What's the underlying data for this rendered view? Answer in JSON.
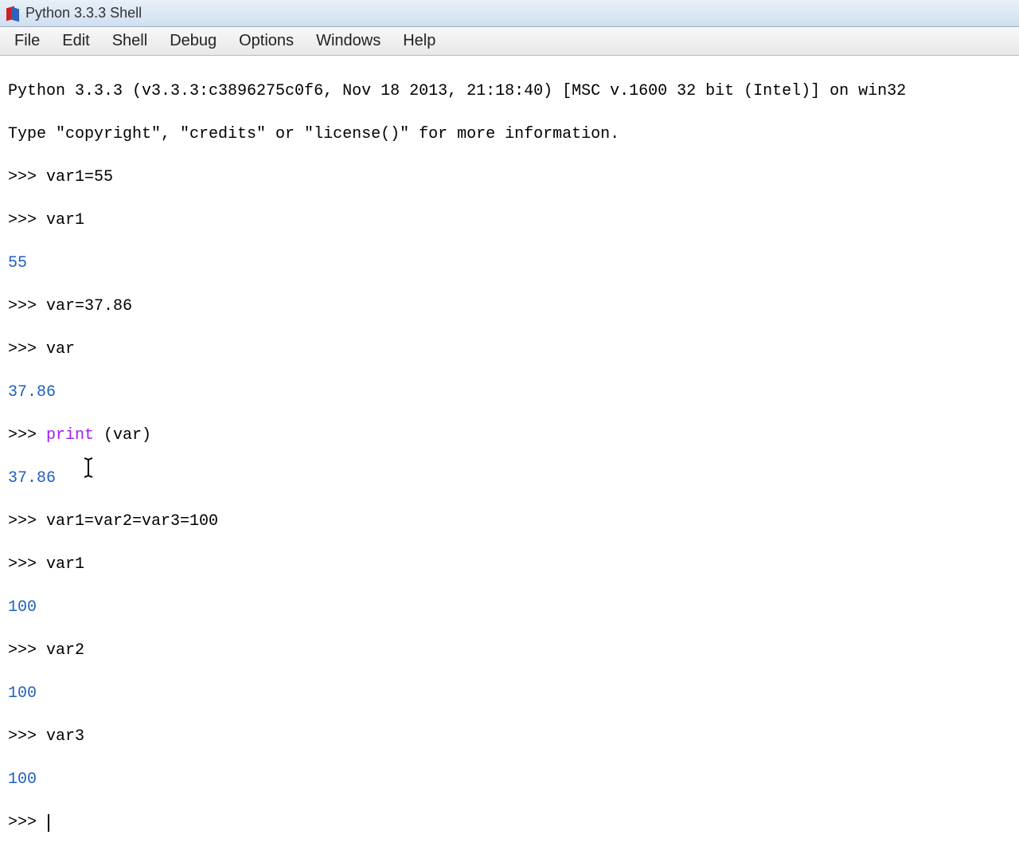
{
  "window": {
    "title": "Python 3.3.3 Shell"
  },
  "menu": {
    "file": "File",
    "edit": "Edit",
    "shell": "Shell",
    "debug": "Debug",
    "options": "Options",
    "windows": "Windows",
    "help": "Help"
  },
  "banner": {
    "line1": "Python 3.3.3 (v3.3.3:c3896275c0f6, Nov 18 2013, 21:18:40) [MSC v.1600 32 bit (Intel)] on win32",
    "line2": "Type \"copyright\", \"credits\" or \"license()\" for more information."
  },
  "session": {
    "prompt": ">>> ",
    "lines": [
      {
        "type": "input",
        "text": "var1=55"
      },
      {
        "type": "input",
        "text": "var1"
      },
      {
        "type": "output",
        "text": "55"
      },
      {
        "type": "input",
        "text": "var=37.86"
      },
      {
        "type": "input",
        "text": "var"
      },
      {
        "type": "output",
        "text": "37.86"
      },
      {
        "type": "input_kw",
        "pre": "",
        "kw": "print",
        "post": " (var)"
      },
      {
        "type": "output",
        "text": "37.86"
      },
      {
        "type": "input",
        "text": "var1=var2=var3=100"
      },
      {
        "type": "input",
        "text": "var1"
      },
      {
        "type": "output",
        "text": "100"
      },
      {
        "type": "input",
        "text": "var2"
      },
      {
        "type": "output",
        "text": "100"
      },
      {
        "type": "input",
        "text": "var3"
      },
      {
        "type": "output",
        "text": "100"
      }
    ]
  }
}
